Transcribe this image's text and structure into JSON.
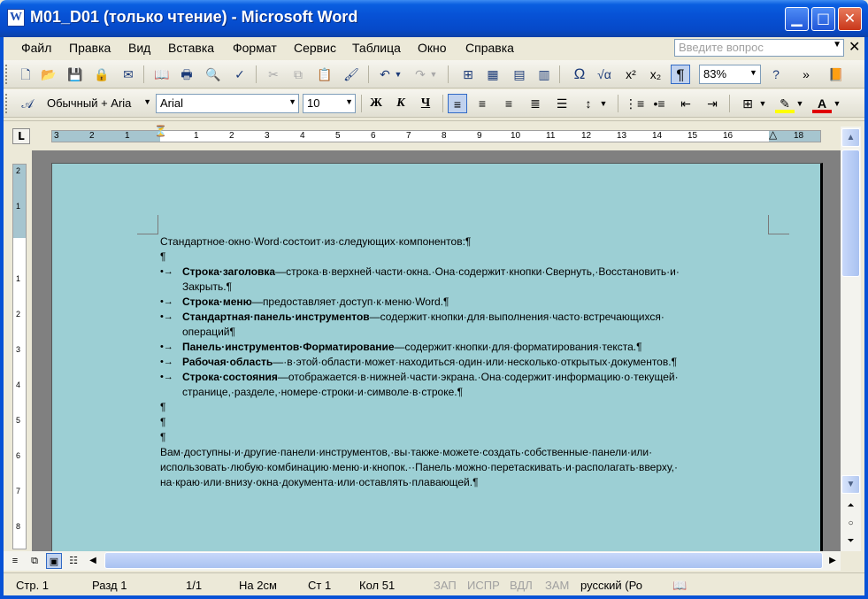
{
  "window": {
    "title": "M01_D01 (только чтение) - Microsoft Word",
    "app_icon": "word-icon",
    "accent_color": "#0752d6"
  },
  "menu": {
    "items": [
      "Файл",
      "Правка",
      "Вид",
      "Вставка",
      "Формат",
      "Сервис",
      "Таблица",
      "Окно",
      "Справка"
    ],
    "help_placeholder": "Введите вопрос"
  },
  "standard_toolbar": {
    "zoom": "83%"
  },
  "formatting_toolbar": {
    "style": "Обычный + Aria",
    "font": "Arial",
    "size": "10",
    "bold": "Ж",
    "italic": "К",
    "underline": "Ч"
  },
  "ruler": {
    "corner": "L",
    "ticks": [
      "3",
      "2",
      "1",
      "1",
      "2",
      "3",
      "4",
      "5",
      "6",
      "7",
      "8",
      "9",
      "10",
      "11",
      "12",
      "13",
      "14",
      "15",
      "16",
      "18"
    ],
    "vticks": [
      "2",
      "1",
      "1",
      "2",
      "3",
      "4",
      "5",
      "6",
      "7",
      "8"
    ]
  },
  "document": {
    "intro": "Стандартное·окно·Word·состоит·из·следующих·компонентов:¶",
    "empty_para": "¶",
    "bullets": [
      {
        "term": "Строка·заголовка",
        "text": "—строка·в·верхней·части·окна.·Она·содержит·кнопки·Свернуть,·Восстановить·и·",
        "cont": "Закрыть.¶"
      },
      {
        "term": "Строка·меню",
        "text": "—предоставляет·доступ·к·меню·Word.¶",
        "cont": ""
      },
      {
        "term": "Стандартная·панель·инструментов",
        "text": "—содержит·кнопки·для·выполнения·часто·встречающихся·",
        "cont": "операций¶"
      },
      {
        "term": "Панель·инструментов·Форматирование",
        "text": "—содержит·кнопки·для·форматирования·текста.¶",
        "cont": ""
      },
      {
        "term": "Рабочая·область",
        "text": "—·в·этой·области·может·находиться·один·или·несколько·открытых·документов.¶",
        "cont": ""
      },
      {
        "term": "Строка·состояния",
        "text": "—отображается·в·нижней·части·экрана.·Она·содержит·информацию·о·текущей·",
        "cont": "странице,·разделе,·номере·строки·и·символе·в·строке.¶"
      }
    ],
    "bullet_mark": "•→",
    "closing_lines": [
      "Вам·доступны·и·другие·панели·инструментов,·вы·также·можете·создать·собственные·панели·или·",
      "использовать·любую·комбинацию·меню·и·кнопок.··Панель·можно·перетаскивать·и·располагать·вверху,·",
      "на·краю·или·внизу·окна·документа·или·оставлять·плавающей.¶"
    ]
  },
  "status": {
    "page": "Стр. 1",
    "section": "Разд 1",
    "pages": "1/1",
    "position": "На 2см",
    "line": "Ст 1",
    "column": "Кол 51",
    "rec": "ЗАП",
    "track": "ИСПР",
    "ext": "ВДЛ",
    "ovr": "ЗАМ",
    "language": "русский (Ро"
  }
}
